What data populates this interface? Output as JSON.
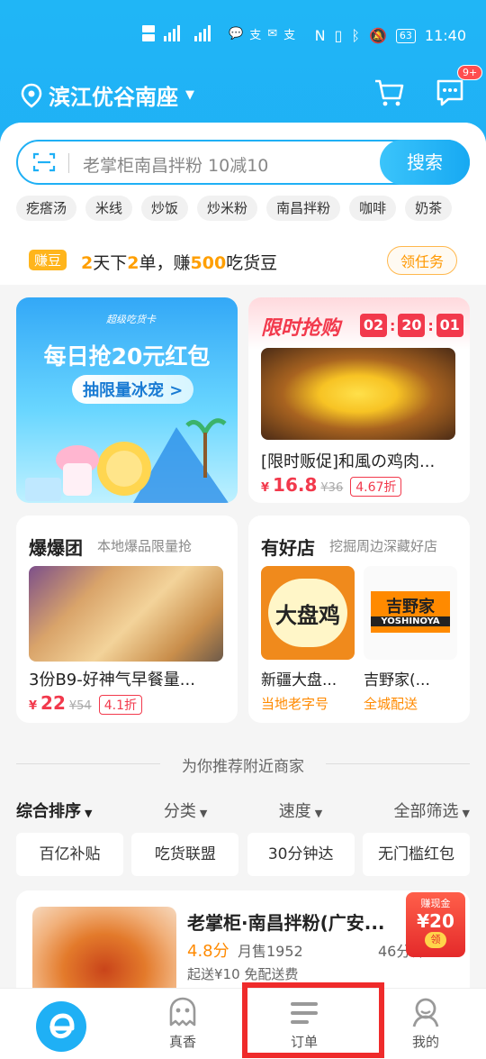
{
  "status_bar": {
    "left_icons": "HD 4G 4G",
    "time": "11:40",
    "battery": "63"
  },
  "header": {
    "location": "滨江优谷南座",
    "message_badge": "9+"
  },
  "search": {
    "placeholder": "老掌柜南昌拌粉 10减10",
    "button": "搜索"
  },
  "quick_tags": [
    "疙瘩汤",
    "米线",
    "炒饭",
    "炒米粉",
    "南昌拌粉",
    "咖啡",
    "奶茶"
  ],
  "earn": {
    "chip": "赚豆",
    "n1": "2",
    "t1": "天下",
    "n2": "2",
    "t2": "单，赚",
    "n3": "500",
    "t3": "吃货豆",
    "task_button": "领任务"
  },
  "promo_card": {
    "logo": "超级吃货卡",
    "headline": "每日抢20元红包",
    "cta": "抽限量冰宠 >"
  },
  "flash_sale": {
    "title": "限时抢购",
    "countdown": [
      "02",
      "20",
      "01"
    ],
    "item_name": "[限时贩促]和風の鸡肉...",
    "yen": "¥",
    "price": "16.8",
    "old_price": "¥36",
    "discount": "4.67折"
  },
  "baobao": {
    "title": "爆爆团",
    "subtitle": "本地爆品限量抢",
    "item_name": "3份B9-好神气早餐量...",
    "yen": "¥",
    "price": "22",
    "old_price": "¥54",
    "discount": "4.1折"
  },
  "good_shops": {
    "title": "有好店",
    "subtitle": "挖掘周边深藏好店",
    "shop1_logo": "大盘鸡",
    "shop1_name": "新疆大盘...",
    "shop1_desc": "当地老字号",
    "shop2_logo": "吉野家",
    "shop2_logo_en": "YOSHINOYA",
    "shop2_name": "吉野家(...",
    "shop2_desc": "全城配送"
  },
  "section_title": "为你推荐附近商家",
  "sort_options": [
    "综合排序",
    "分类",
    "速度",
    "全部筛选"
  ],
  "filter_chips": [
    "百亿补贴",
    "吃货联盟",
    "30分钟达",
    "无门槛红包"
  ],
  "store": {
    "name": "老掌柜·南昌拌粉(广安...",
    "rating": "4.8分",
    "monthly_sales": "月售1952",
    "delivery_time": "46分钟",
    "fee_info": "起送¥10  免配送费"
  },
  "coupon": {
    "label": "赚现金",
    "amount": "¥20",
    "action": "领"
  },
  "bottom_nav": [
    {
      "label": ""
    },
    {
      "label": "真香"
    },
    {
      "label": "订单"
    },
    {
      "label": "我的"
    }
  ],
  "colors": {
    "brand_blue": "#1fb0f5",
    "price_red": "#f2394c",
    "orange": "#ff8a00",
    "highlight_box": "#ef2b2b"
  }
}
